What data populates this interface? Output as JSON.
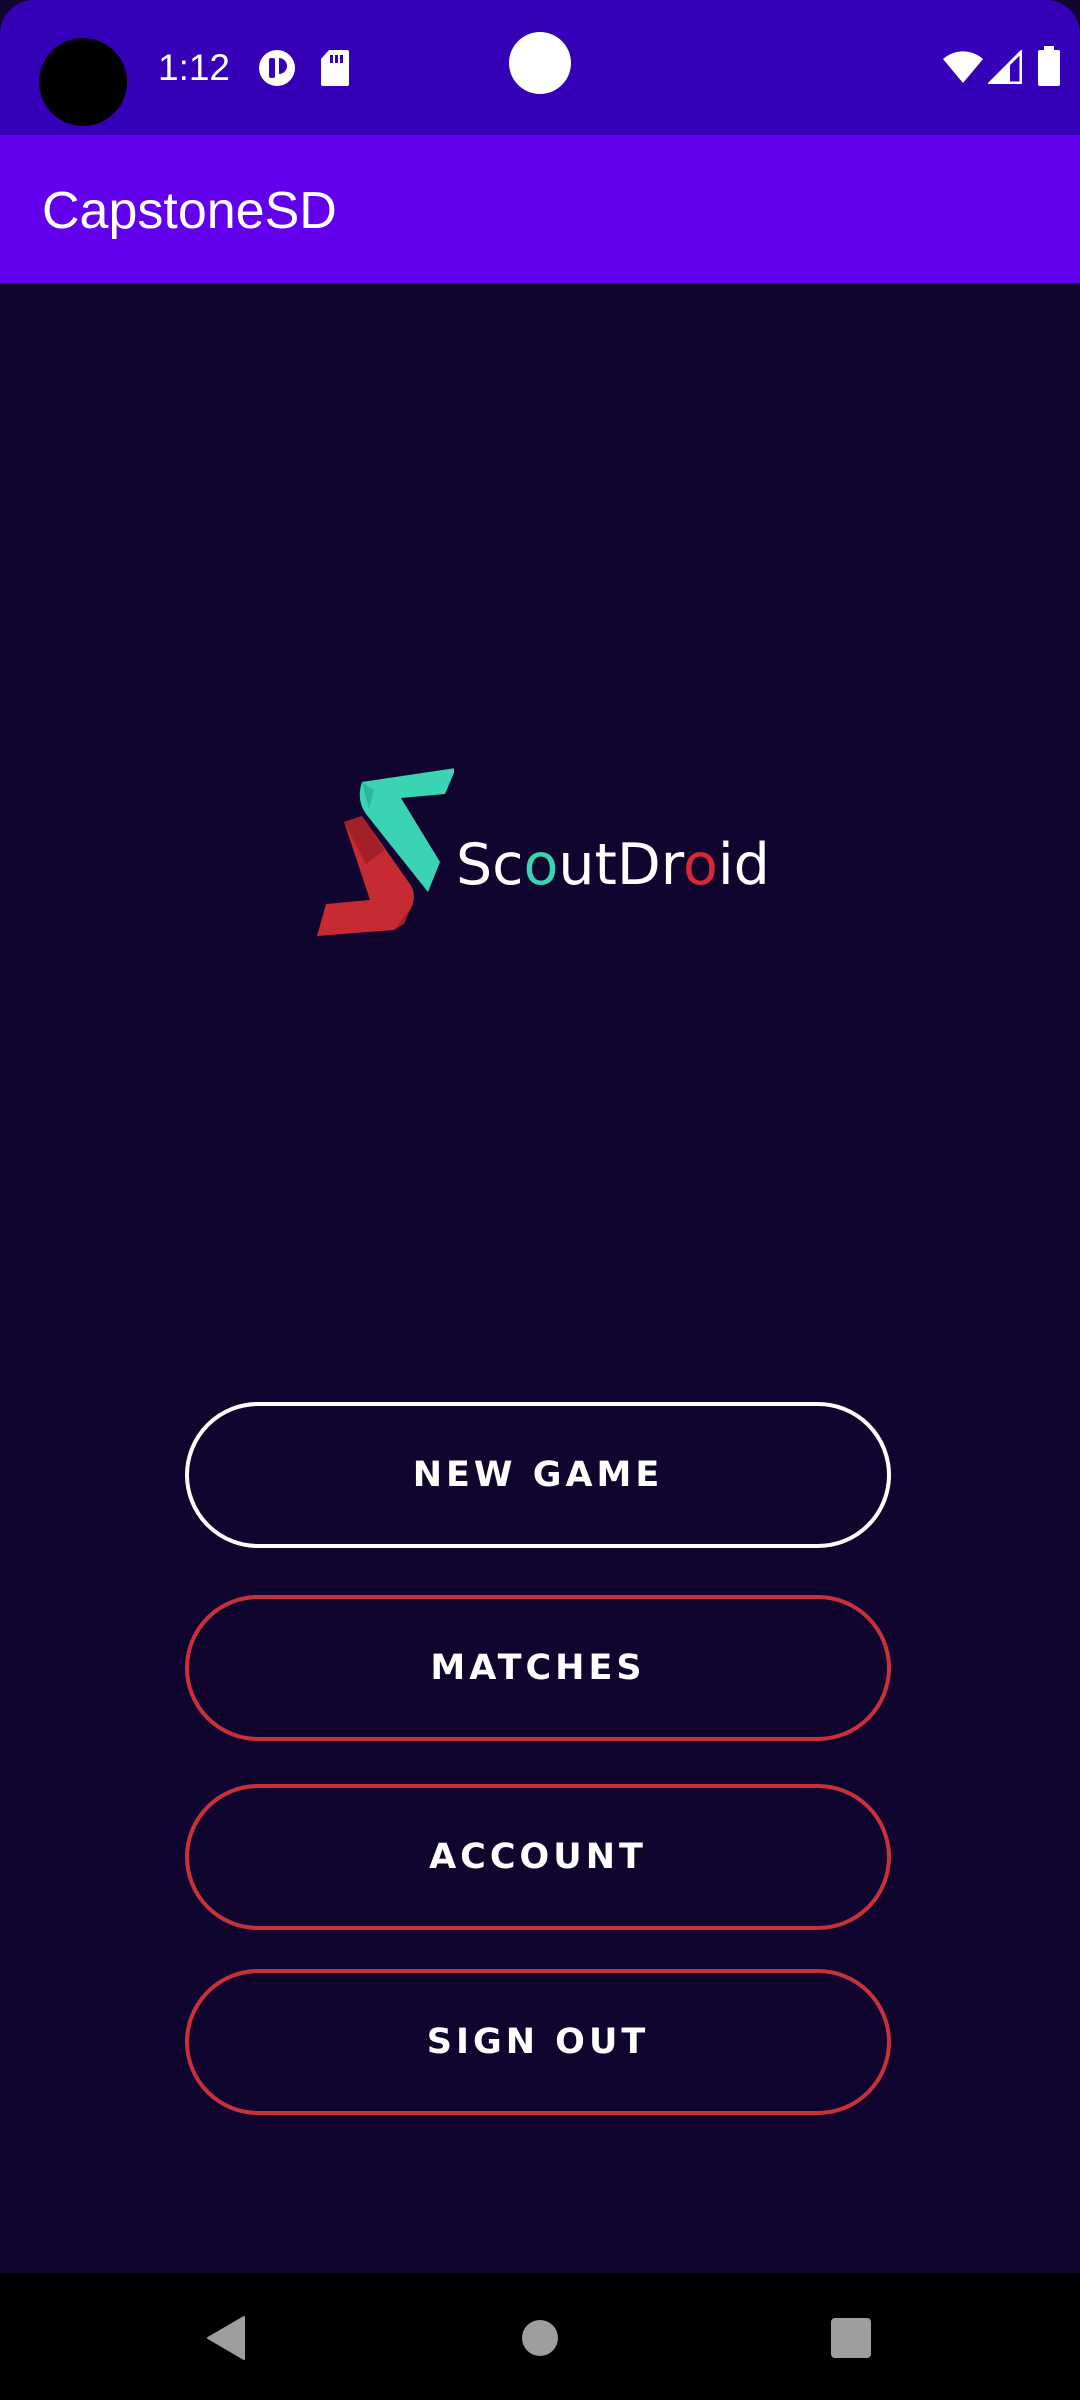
{
  "status_bar": {
    "time": "1:12",
    "icons": [
      "camera-hole",
      "media-icon",
      "sd-card-icon",
      "wifi-icon",
      "signal-icon",
      "battery-icon"
    ],
    "background": "#3600b8"
  },
  "app_bar": {
    "title": "CapstoneSD",
    "background": "#6200ee"
  },
  "logo": {
    "text_parts": [
      "Sc",
      "o",
      "utDr",
      "o",
      "id"
    ],
    "colors": {
      "teal": "#3ad4b4",
      "red": "#d7283a"
    }
  },
  "menu": {
    "new_game": "NEW GAME",
    "matches": "MATCHES",
    "account": "ACCOUNT",
    "sign_out": "SIGN OUT"
  },
  "colors": {
    "screen_background": "#10052e",
    "primary_border": "#ffffff",
    "secondary_border": "#c8303b"
  },
  "nav_bar": {
    "icons": [
      "back-icon",
      "home-icon",
      "recents-icon"
    ]
  }
}
